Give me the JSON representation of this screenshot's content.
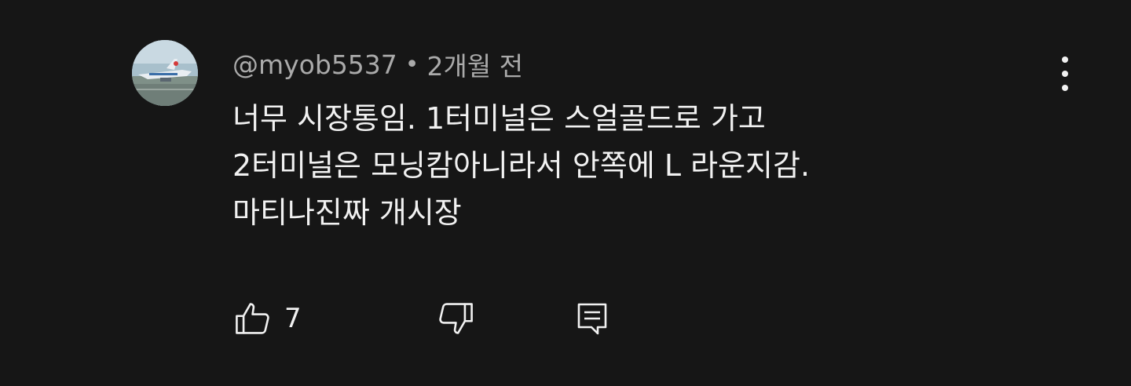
{
  "comment": {
    "author": "@myob5537",
    "separator": "•",
    "time": "2개월 전",
    "lines": [
      "너무 시장통임. 1터미널은 스얼골드로 가고",
      "2터미널은 모닝캄아니라서 안쪽에 L 라운지감.",
      "마티나진짜 개시장"
    ],
    "likes": "7"
  },
  "icons": {
    "avatar": "avatar-airplane-photo",
    "menu": "more-vertical-icon",
    "like": "thumb-up-icon",
    "dislike": "thumb-down-icon",
    "reply": "reply-comment-icon"
  },
  "colors": {
    "background": "#161616",
    "text": "#f1f1f1",
    "meta": "#aaaaaa"
  }
}
